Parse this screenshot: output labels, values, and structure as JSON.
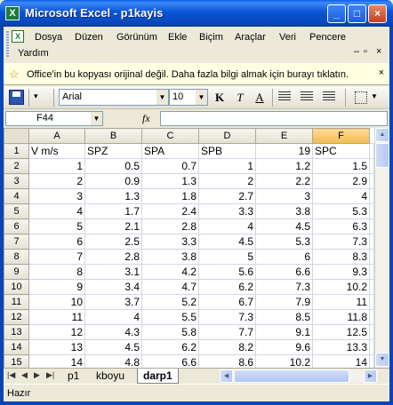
{
  "window": {
    "title": "Microsoft Excel - p1kayis",
    "app_icon": "excel-icon"
  },
  "menu": {
    "items": [
      "Dosya",
      "Düzen",
      "Görünüm",
      "Ekle",
      "Biçim",
      "Araçlar",
      "Veri",
      "Pencere"
    ],
    "row2_items": [
      "Yardım"
    ]
  },
  "infobar": {
    "text": "Office'in bu kopyası orijinal değil.  Daha fazla bilgi almak için burayı tıklatın.",
    "close": "×"
  },
  "toolbar": {
    "font_name": "Arial",
    "font_size": "10",
    "bold_label": "K",
    "italic_label": "T",
    "underline_label": "A"
  },
  "formula_bar": {
    "name_box": "F44",
    "fx_label": "fx",
    "formula": ""
  },
  "sheet": {
    "columns": [
      "A",
      "B",
      "C",
      "D",
      "E",
      "F"
    ],
    "selected_column": "F",
    "rows": [
      {
        "n": "1",
        "cells": [
          "V m/s",
          "SPZ",
          "SPA",
          "SPB",
          "19",
          "SPC"
        ]
      },
      {
        "n": "2",
        "cells": [
          "1",
          "0.5",
          "0.7",
          "1",
          "1.2",
          "1.5"
        ]
      },
      {
        "n": "3",
        "cells": [
          "2",
          "0.9",
          "1.3",
          "2",
          "2.2",
          "2.9"
        ]
      },
      {
        "n": "4",
        "cells": [
          "3",
          "1.3",
          "1.8",
          "2.7",
          "3",
          "4"
        ]
      },
      {
        "n": "5",
        "cells": [
          "4",
          "1.7",
          "2.4",
          "3.3",
          "3.8",
          "5.3"
        ]
      },
      {
        "n": "6",
        "cells": [
          "5",
          "2.1",
          "2.8",
          "4",
          "4.5",
          "6.3"
        ]
      },
      {
        "n": "7",
        "cells": [
          "6",
          "2.5",
          "3.3",
          "4.5",
          "5.3",
          "7.3"
        ]
      },
      {
        "n": "8",
        "cells": [
          "7",
          "2.8",
          "3.8",
          "5",
          "6",
          "8.3"
        ]
      },
      {
        "n": "9",
        "cells": [
          "8",
          "3.1",
          "4.2",
          "5.6",
          "6.6",
          "9.3"
        ]
      },
      {
        "n": "10",
        "cells": [
          "9",
          "3.4",
          "4.7",
          "6.2",
          "7.3",
          "10.2"
        ]
      },
      {
        "n": "11",
        "cells": [
          "10",
          "3.7",
          "5.2",
          "6.7",
          "7.9",
          "11"
        ]
      },
      {
        "n": "12",
        "cells": [
          "11",
          "4",
          "5.5",
          "7.3",
          "8.5",
          "11.8"
        ]
      },
      {
        "n": "13",
        "cells": [
          "12",
          "4.3",
          "5.8",
          "7.7",
          "9.1",
          "12.5"
        ]
      },
      {
        "n": "14",
        "cells": [
          "13",
          "4.5",
          "6.2",
          "8.2",
          "9.6",
          "13.3"
        ]
      },
      {
        "n": "15",
        "cells": [
          "14",
          "4.8",
          "6.6",
          "8.6",
          "10.2",
          "14"
        ]
      }
    ]
  },
  "tabs": {
    "items": [
      "p1",
      "kboyu",
      "darp1"
    ],
    "active": "darp1"
  },
  "status": {
    "text": "Hazır"
  },
  "colors": {
    "titlebar": "#0a55d6",
    "selected_header": "#f5b94c",
    "gridline": "#d0d7e5"
  }
}
